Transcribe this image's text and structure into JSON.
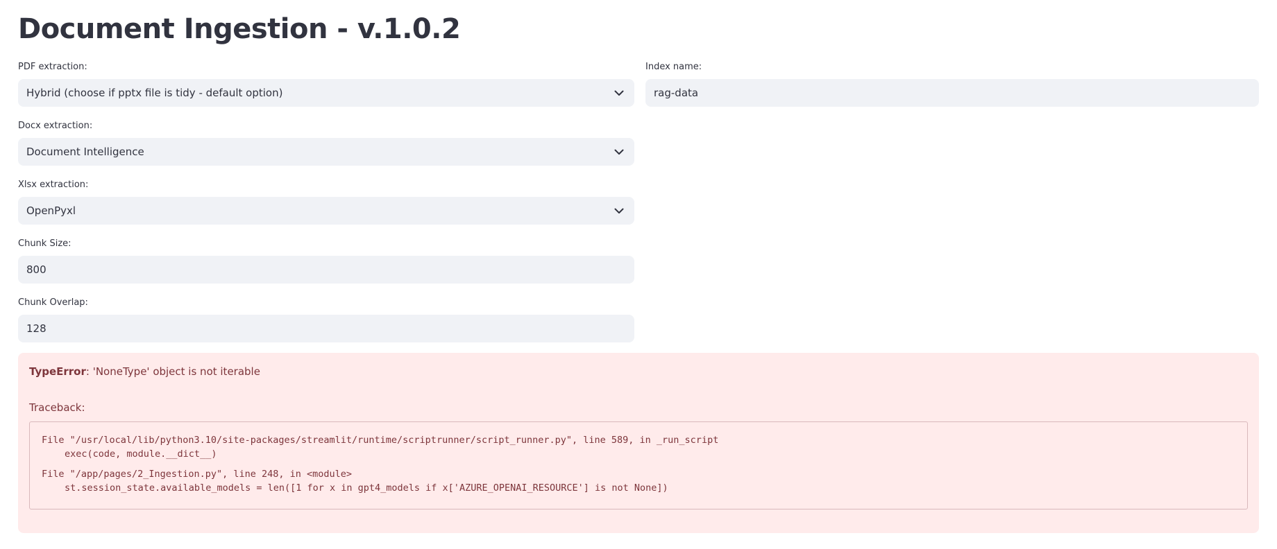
{
  "page": {
    "title": "Document Ingestion - v.1.0.2"
  },
  "form": {
    "pdf_extraction": {
      "label": "PDF extraction:",
      "value": "Hybrid (choose if pptx file is tidy - default option)",
      "icon": "chevron-down-icon"
    },
    "index_name": {
      "label": "Index name:",
      "value": "rag-data"
    },
    "docx_extraction": {
      "label": "Docx extraction:",
      "value": "Document Intelligence",
      "icon": "chevron-down-icon"
    },
    "xlsx_extraction": {
      "label": "Xlsx extraction:",
      "value": "OpenPyxl",
      "icon": "chevron-down-icon"
    },
    "chunk_size": {
      "label": "Chunk Size:",
      "value": "800"
    },
    "chunk_overlap": {
      "label": "Chunk Overlap:",
      "value": "128"
    }
  },
  "error": {
    "type": "TypeError",
    "message": ": 'NoneType' object is not iterable",
    "traceback_label": "Traceback:",
    "frames": [
      {
        "file": "File \"/usr/local/lib/python3.10/site-packages/streamlit/runtime/scriptrunner/script_runner.py\", line 589, in _run_script",
        "code": "exec(code, module.__dict__)"
      },
      {
        "file": "File \"/app/pages/2_Ingestion.py\", line 248, in <module>",
        "code": "st.session_state.available_models = len([1 for x in gpt4_models if x['AZURE_OPENAI_RESOURCE'] is not None])"
      }
    ]
  },
  "colors": {
    "input_bg": "#f0f2f6",
    "error_bg": "#ffebeb",
    "error_text": "#7d353b",
    "text": "#31333f"
  }
}
